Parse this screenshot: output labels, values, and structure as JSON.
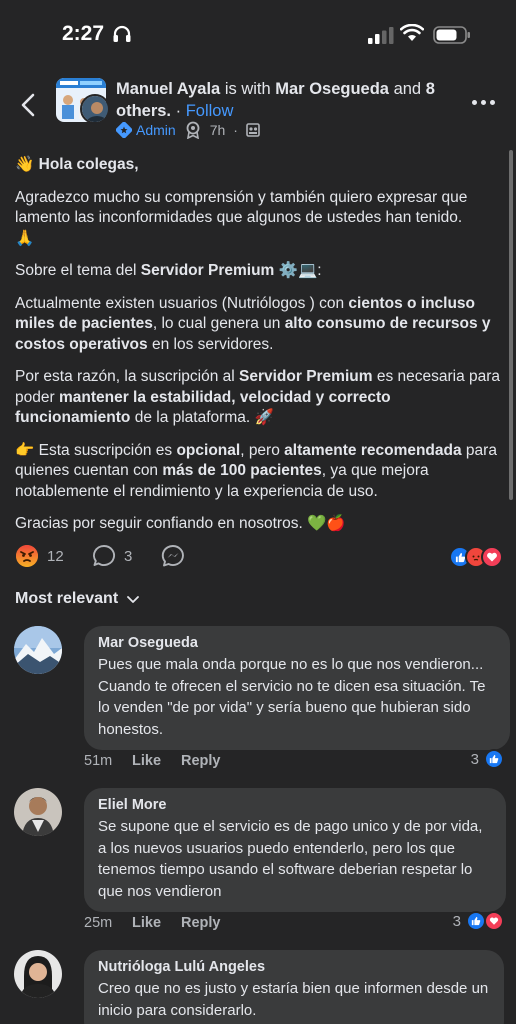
{
  "status_bar": {
    "time": "2:27"
  },
  "post": {
    "author": "Manuel Ayala",
    "with_text": "is with",
    "tagged": "Mar Osegueda",
    "and_text": "and",
    "others": "8 others.",
    "follow": "Follow",
    "role_badge": "Admin",
    "time": "7h",
    "greeting": "Hola colegas,",
    "p1": "Agradezco mucho su comprensión y también quiero expresar que lamento las inconformidades que algunos de ustedes han tenido.",
    "p2_a": "Sobre el tema del ",
    "p2_b": "Servidor Premium",
    "p3_a": "Actualmente existen usuarios (Nutriólogos ) con ",
    "p3_b": "cientos o incluso miles de pacientes",
    "p3_c": ", lo cual genera un ",
    "p3_d": "alto consumo de recursos y costos operativos",
    "p3_e": " en los servidores.",
    "p4_a": "Por esta razón, la suscripción al ",
    "p4_b": "Servidor Premium",
    "p4_c": " es necesaria para poder ",
    "p4_d": "mantener la estabilidad, velocidad y correcto funcionamiento",
    "p4_e": " de la plataforma.",
    "p5_a": "Esta suscripción es ",
    "p5_b": "opcional",
    "p5_c": ", pero ",
    "p5_d": "altamente recomendada",
    "p5_e": " para quienes cuentan con ",
    "p5_f": "más de 100 pacientes",
    "p5_g": ", ya que mejora notablemente el rendimiento y la experiencia de uso.",
    "p6": "Gracias por seguir confiando en nosotros.",
    "reaction_count": "12",
    "comment_count": "3"
  },
  "sort_label": "Most relevant",
  "comments": [
    {
      "name": "Mar Osegueda",
      "text": "Pues que mala onda porque no es lo que nos vendieron... Cuando te ofrecen el servicio no te dicen esa situación. Te lo venden \"de por vida\" y sería bueno que hubieran sido honestos.",
      "time": "51m",
      "like": "Like",
      "reply": "Reply",
      "reactions": "3"
    },
    {
      "name": "Eliel More",
      "text": "Se supone que el servicio es de pago unico y de por vida, a los nuevos usuarios puedo entenderlo, pero los que tenemos tiempo usando el software deberian respetar lo que nos vendieron",
      "time": "25m",
      "like": "Like",
      "reply": "Reply",
      "reactions": "3"
    },
    {
      "name": "Nutrióloga Lulú Angeles",
      "text": "Creo que no es justo y estaría bien que informen desde un inicio para considerarlo."
    }
  ],
  "colors": {
    "background": "#252526",
    "bubble": "#3a3b3c",
    "link": "#4599ff",
    "like_blue": "#1877f2",
    "love_red": "#f33e58",
    "angry_orange": "#e9710f"
  }
}
